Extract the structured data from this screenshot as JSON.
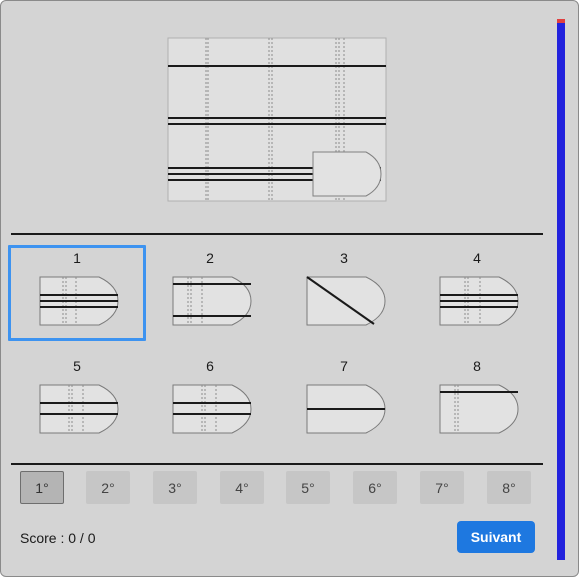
{
  "options": [
    {
      "number": "1"
    },
    {
      "number": "2"
    },
    {
      "number": "3"
    },
    {
      "number": "4"
    },
    {
      "number": "5"
    },
    {
      "number": "6"
    },
    {
      "number": "7"
    },
    {
      "number": "8"
    }
  ],
  "selected_option": "1",
  "rotations": [
    "1°",
    "2°",
    "3°",
    "4°",
    "5°",
    "6°",
    "7°",
    "8°"
  ],
  "selected_rotation": "1°",
  "score_text": "Score : 0 / 0",
  "next_label": "Suivant",
  "progress_fraction": 0.0,
  "colors": {
    "panel": "#d4d4d4",
    "selection": "#3d93f0",
    "next_button": "#1e78e0",
    "progress_track": "#2222dd",
    "progress_marker": "#e04040"
  }
}
